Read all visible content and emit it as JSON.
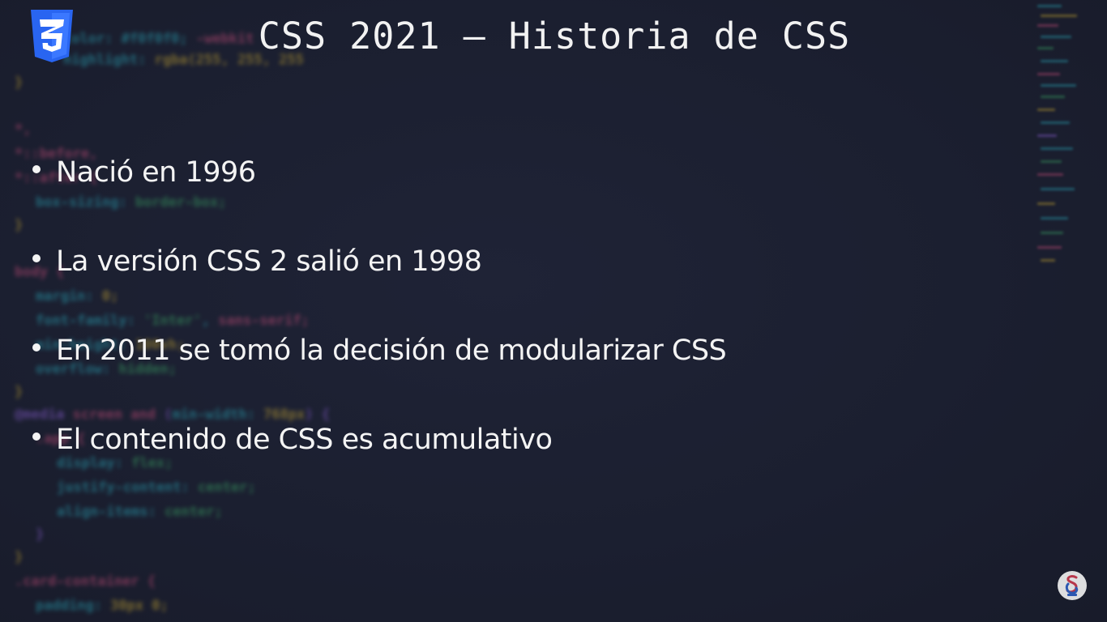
{
  "slide": {
    "title": "CSS 2021 – Historia de CSS",
    "bullets": [
      "Nació en 1996",
      "La versión CSS 2 salió en 1998",
      "En 2011 se tomó la decisión de modularizar CSS",
      "El contenido de CSS es acumulativo"
    ]
  },
  "logo": {
    "icon": "css3-logo-icon",
    "color": "#2965f1",
    "shade": "#1c51c7"
  },
  "watermark": {
    "icon": "channel-watermark-icon"
  },
  "colors": {
    "background": "#1b1f30",
    "text": "#f4f4f4",
    "code_cyan": "#2aa7b8",
    "code_green": "#3aa564",
    "code_yellow": "#c9a832",
    "code_pink": "#c94d79",
    "code_purple": "#8c5fd4"
  }
}
